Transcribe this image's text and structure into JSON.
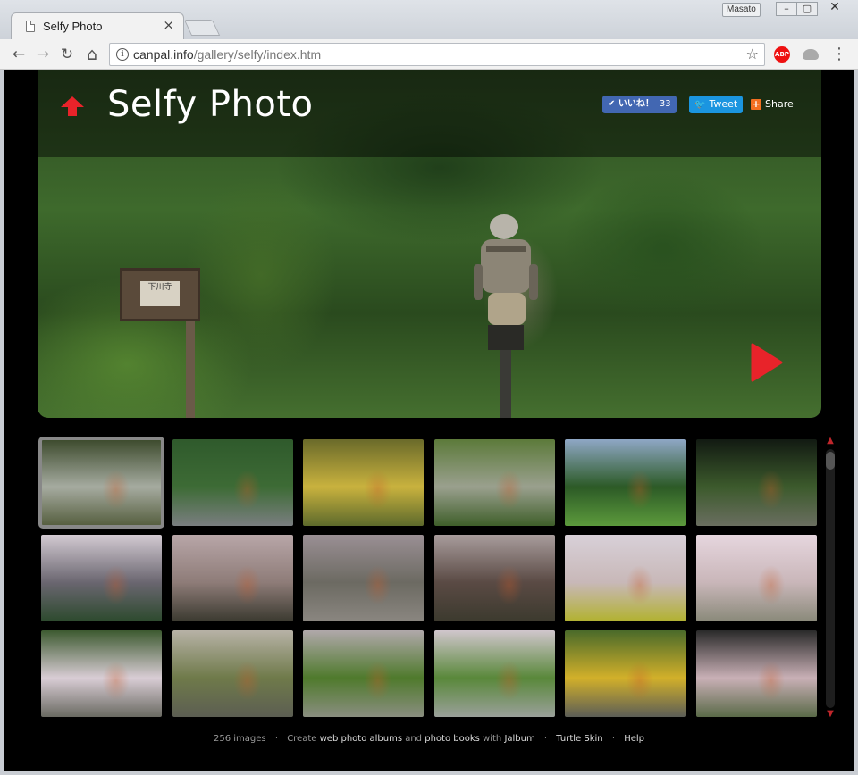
{
  "browser": {
    "tab_title": "Selfy Photo",
    "tab_close": "×",
    "profile_name": "Masato",
    "win_min": "–",
    "win_max": "▢",
    "win_close": "✕",
    "url_host": "canpal.info",
    "url_path": "/gallery/selfy/index.htm",
    "back": "←",
    "forward": "→",
    "reload": "↻",
    "home": "⌂",
    "star": "☆",
    "menu": "⋮",
    "abp_label": "ABP"
  },
  "album": {
    "title": "Selfy Photo",
    "like_label": "いいね！",
    "like_count": "33",
    "tweet_label": "Tweet",
    "share_label": "Share",
    "sign_text": "下川寺"
  },
  "thumbnails": [
    {
      "colors": [
        "#3c4a2c",
        "#a6aba0",
        "#555e3e"
      ]
    },
    {
      "colors": [
        "#2f5a2c",
        "#3d6b35",
        "#7a7e80"
      ]
    },
    {
      "colors": [
        "#6a6a2a",
        "#c9b23e",
        "#5d6a2c"
      ]
    },
    {
      "colors": [
        "#5c7a3a",
        "#9aa08e",
        "#3f5f2a"
      ]
    },
    {
      "colors": [
        "#8fa7c5",
        "#2c5a26",
        "#5c9a3c"
      ]
    },
    {
      "colors": [
        "#121a12",
        "#3c5a2c",
        "#6a6e60"
      ]
    },
    {
      "colors": [
        "#d3cad2",
        "#6a6670",
        "#2d4a2e"
      ]
    },
    {
      "colors": [
        "#b8a6a8",
        "#8e7c78",
        "#3b3a30"
      ]
    },
    {
      "colors": [
        "#9a8f94",
        "#6c6a62",
        "#8a8680"
      ]
    },
    {
      "colors": [
        "#a89c9c",
        "#5a4a44",
        "#3c3a2e"
      ]
    },
    {
      "colors": [
        "#d8d0d8",
        "#c8b8b8",
        "#b2b230"
      ]
    },
    {
      "colors": [
        "#e6d6de",
        "#c9b6b9",
        "#8a8a7a"
      ]
    },
    {
      "colors": [
        "#3d5a30",
        "#d9cdd5",
        "#6a6a62"
      ]
    },
    {
      "colors": [
        "#b7b2a6",
        "#6f7a4a",
        "#5c5e52"
      ]
    },
    {
      "colors": [
        "#b0a8aa",
        "#4f7a2c",
        "#8a8e80"
      ]
    },
    {
      "colors": [
        "#d0c6cc",
        "#59883a",
        "#9aa09a"
      ]
    },
    {
      "colors": [
        "#4a6a2a",
        "#d2b02a",
        "#5c5e56"
      ]
    },
    {
      "colors": [
        "#2a2a2a",
        "#c9b0b6",
        "#5a6a48"
      ]
    }
  ],
  "scroll": {
    "up": "▲",
    "down": "▼"
  },
  "footer": {
    "count": "256 images",
    "sep": "·",
    "create_prefix": "Create",
    "web_albums": "web photo albums",
    "and_text": "and",
    "photo_books": "photo books",
    "with_text": "with",
    "jalbum": "Jalbum",
    "skin": "Turtle Skin",
    "help": "Help"
  },
  "colors": {
    "accent_red": "#e8232a",
    "like_blue": "#4267b2",
    "tweet_blue": "#1b95e0",
    "share_orange": "#f26f21"
  }
}
